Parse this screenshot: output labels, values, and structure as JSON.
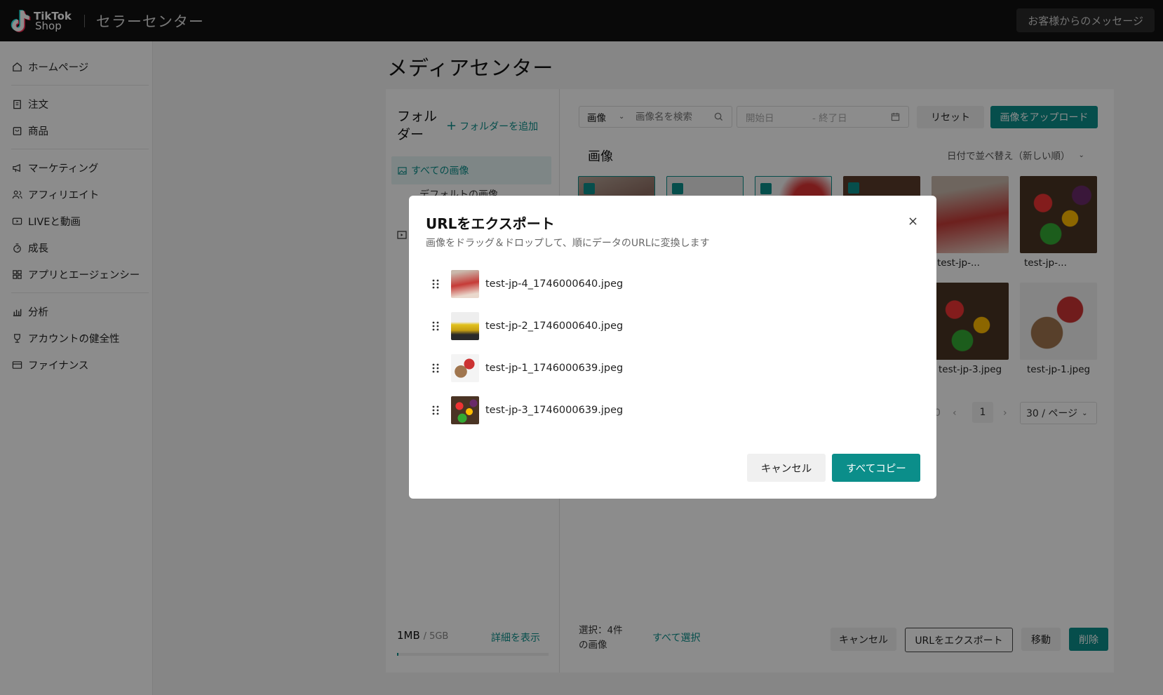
{
  "topbar": {
    "logo_line1": "TikTok",
    "logo_line2": "Shop",
    "app_title": "セラーセンター",
    "messages_label": "お客様からのメッセージ"
  },
  "sidebar": {
    "items": [
      {
        "label": "ホームページ",
        "icon": "home-icon"
      },
      {
        "label": "注文",
        "icon": "clipboard-icon"
      },
      {
        "label": "商品",
        "icon": "box-icon"
      },
      {
        "label": "マーケティング",
        "icon": "megaphone-icon"
      },
      {
        "label": "アフィリエイト",
        "icon": "users-icon"
      },
      {
        "label": "LIVEと動画",
        "icon": "video-icon"
      },
      {
        "label": "成長",
        "icon": "growth-icon"
      },
      {
        "label": "アプリとエージェンシー",
        "icon": "apps-icon"
      },
      {
        "label": "分析",
        "icon": "chart-icon"
      },
      {
        "label": "アカウントの健全性",
        "icon": "trophy-icon"
      },
      {
        "label": "ファイナンス",
        "icon": "wallet-icon"
      }
    ]
  },
  "main": {
    "page_title": "メディアセンター",
    "folder_title": "フォルダー",
    "add_folder_label": "フォルダーを追加",
    "folder_all": "すべての画像",
    "folder_default": "デフォルトの画像",
    "storage_used": "1MB",
    "storage_total": "/ 5GB",
    "storage_fraction": 0.0002,
    "details_link": "詳細を表示",
    "type_select": "画像",
    "search_placeholder": "画像名を検索",
    "date_start_placeholder": "開始日",
    "date_end_placeholder": "- 終了日",
    "reset_label": "リセット",
    "upload_label": "画像をアップロード",
    "images_heading": "画像",
    "sort_label": "日付で並べ替え（新しい順）",
    "thumb_labels": [
      "test-jp-...",
      "test-jp-...",
      "test-jp-3.jpeg",
      "test-jp-1.jpeg"
    ],
    "pager": {
      "prev_count": "0",
      "current": "1",
      "page_size": "30 / ページ"
    },
    "bottom": {
      "selected_text": "選択：4件の画像",
      "select_all": "すべて選択",
      "cancel": "キャンセル",
      "export": "URLをエクスポート",
      "move": "移動",
      "delete": "削除"
    }
  },
  "modal": {
    "title": "URLをエクスポート",
    "subtitle": "画像をドラッグ＆ドロップして、順にデータのURLに変換します",
    "files": [
      {
        "name": "test-jp-4_1746000640.jpeg",
        "thumb": "woman-red-dress"
      },
      {
        "name": "test-jp-2_1746000640.jpeg",
        "thumb": "yellow-car"
      },
      {
        "name": "test-jp-1_1746000639.jpeg",
        "thumb": "gift-boxes"
      },
      {
        "name": "test-jp-3_1746000639.jpeg",
        "thumb": "vegetables"
      }
    ],
    "cancel_label": "キャンセル",
    "copy_all_label": "すべてコピー"
  },
  "colors": {
    "accent": "#0b8e8a",
    "topbar": "#121212"
  }
}
